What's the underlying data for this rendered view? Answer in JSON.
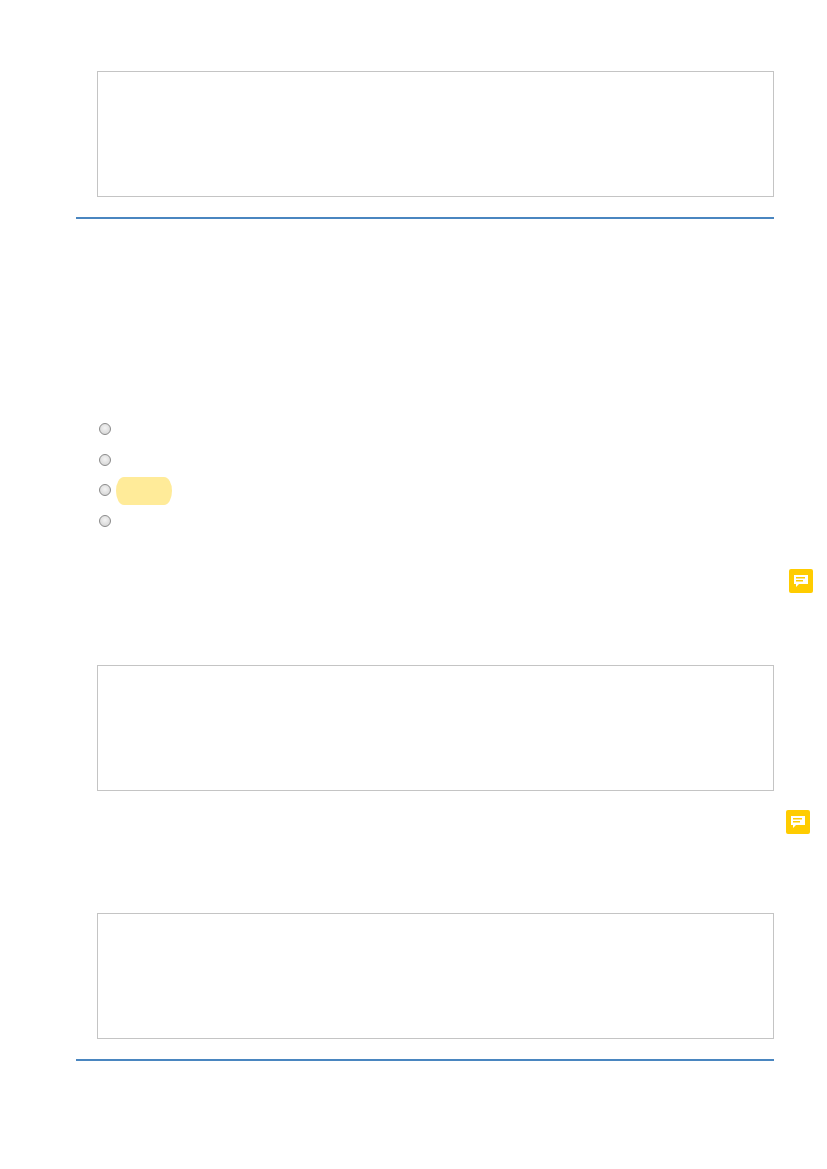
{
  "blocks": [
    {
      "kind": "answer_box"
    },
    {
      "kind": "rule"
    },
    {
      "kind": "radio_group",
      "options": [
        {
          "selected": false,
          "highlighted": false
        },
        {
          "selected": false,
          "highlighted": false
        },
        {
          "selected": false,
          "highlighted": true
        },
        {
          "selected": false,
          "highlighted": false
        }
      ]
    },
    {
      "kind": "comment_note"
    },
    {
      "kind": "answer_box"
    },
    {
      "kind": "comment_note"
    },
    {
      "kind": "answer_box"
    },
    {
      "kind": "rule"
    }
  ]
}
